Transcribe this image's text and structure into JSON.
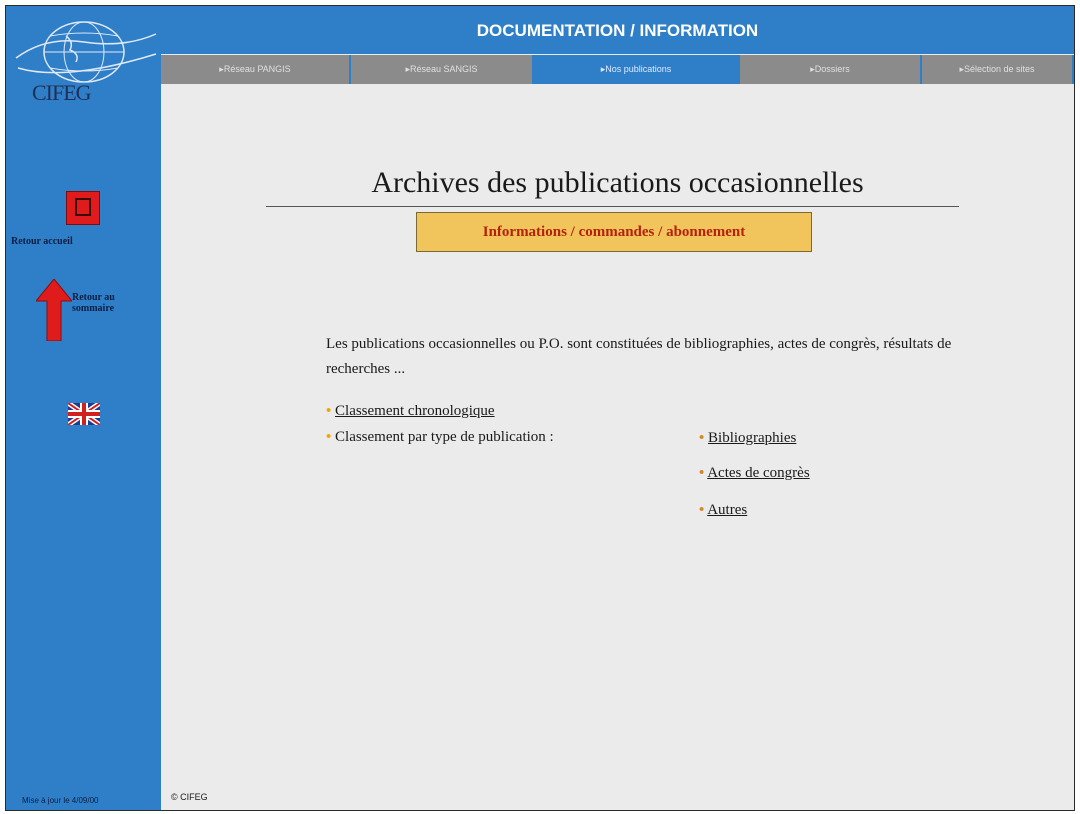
{
  "sidebar": {
    "logo_text": "CIFEG",
    "home_label": "Retour accueil",
    "up_label": "Retour au sommaire",
    "footer_text": "Mise à jour le 4/09/00"
  },
  "header": {
    "title": "DOCUMENTATION / INFORMATION",
    "nav": [
      {
        "label": "▸Réseau PANGIS"
      },
      {
        "label": "▸Réseau SANGIS"
      },
      {
        "label": "▸Nos publications"
      },
      {
        "label": "▸Dossiers"
      },
      {
        "label": "▸Sélection de sites"
      }
    ],
    "active_tab_index": 2
  },
  "main": {
    "title": "Archives des publications occasionnelles",
    "info_button": "Informations / commandes / abonnement",
    "intro": "Les publications occasionnelles ou P.O. sont constituées de bibliographies, actes de congrès, résultats de recherches ...",
    "chronological_link": "Classement chronologique",
    "by_type_label": "Classement par type de publication :",
    "type_links": [
      "Bibliographies",
      "Actes de congrès",
      "Autres"
    ],
    "copyright": "© CIFEG"
  },
  "colors": {
    "blue": "#2f7fc8",
    "content_bg": "#ebebeb",
    "tab_grey": "#8b8b8b",
    "info_box": "#f2c55c",
    "info_text": "#b3220d"
  }
}
